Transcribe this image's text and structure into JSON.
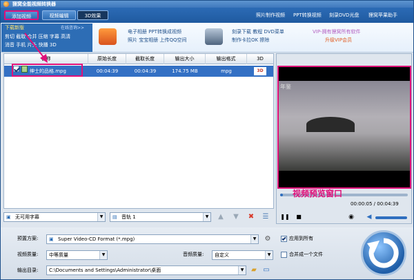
{
  "window": {
    "title": "狸窝全能视频转换器"
  },
  "toolbar": {
    "tabs": [
      {
        "label": "添加视频"
      },
      {
        "label": "视频编辑"
      },
      {
        "label": "3D效果"
      }
    ],
    "menu": [
      {
        "label": "照片制作视频"
      },
      {
        "label": "PPT转换视频"
      },
      {
        "label": "刻录DVD光盘"
      },
      {
        "label": "狸窝苹果助手"
      }
    ]
  },
  "banner": {
    "download": {
      "title": "下载新版",
      "subtitle": "在线咨询>>",
      "rows": [
        "剪切 截取 合并 压缩 字幕 高清",
        "消音 手机 片头 快播 3D"
      ]
    },
    "promo1": [
      "电子相册 PPT转换成视频",
      "照片 宝宝相册 上传QQ空间"
    ],
    "promo2": [
      "刻录下载 教程 DVD菜单",
      "制作卡拉OK 擦除"
    ],
    "vip_line1": "VIP-拥有狸窝所有软件",
    "vip_line2": "升级VIP会员"
  },
  "list": {
    "columns": [
      "名称",
      "原始长度",
      "截取长度",
      "输出大小",
      "输出格式",
      "3D"
    ],
    "rows": [
      {
        "name": "绅士的品格.mpg",
        "original": "00:04:39",
        "cut": "00:04:39",
        "size": "174.75 MB",
        "format": "mpg",
        "threed": "3D"
      }
    ]
  },
  "list_bottom": {
    "subtitle_select": "无可用字幕",
    "audio_select": "音轨 1"
  },
  "preview": {
    "watermark": "年鉴",
    "label": "视频预览窗口",
    "time": "00:00:05 / 00:04:39",
    "progress": 0.02
  },
  "settings": {
    "preset_label": "预置方案:",
    "preset_value": "Super Video-CD Format (*.mpg)",
    "apply_all": "应用到所有",
    "video_quality_label": "视频质量:",
    "video_quality_value": "中等质量",
    "audio_quality_label": "音频质量:",
    "audio_quality_value": "自定义",
    "merge_label": "合并成一个文件",
    "output_label": "输出目录:",
    "output_value": "C:\\Documents and Settings\\Administrator\\桌面"
  }
}
